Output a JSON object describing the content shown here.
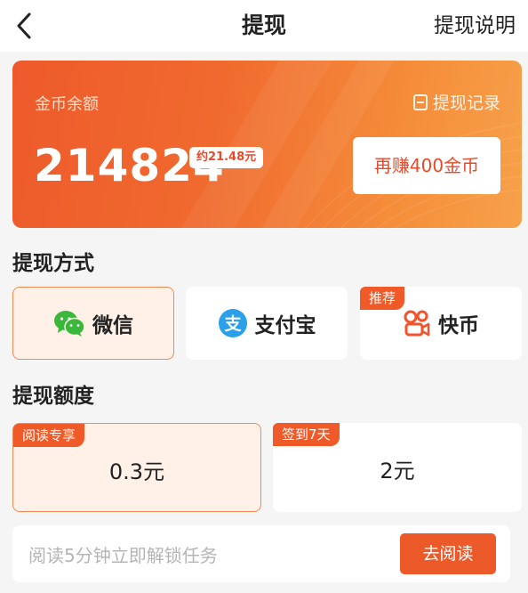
{
  "nav": {
    "title": "提现",
    "help_label": "提现说明",
    "back_icon": "chevron-left-icon"
  },
  "balance": {
    "label": "金币余额",
    "records_label": "提现记录",
    "coins": "214824",
    "approx_cash": "约21.48元",
    "earn_button": "再赚400金币"
  },
  "methods_section": {
    "title": "提现方式",
    "methods": [
      {
        "label": "微信",
        "icon": "wechat-icon",
        "selected": true
      },
      {
        "label": "支付宝",
        "icon": "alipay-icon",
        "selected": false
      },
      {
        "label": "快币",
        "icon": "kuaishou-icon",
        "tag": "推荐",
        "selected": false
      }
    ]
  },
  "amount_section": {
    "title": "提现额度",
    "options": [
      {
        "value": "0.3元",
        "tag": "阅读专享",
        "selected": true
      },
      {
        "value": "2元",
        "tag": "签到7天",
        "selected": false
      }
    ]
  },
  "task": {
    "text": "阅读5分钟立即解锁任务",
    "button": "去阅读"
  },
  "colors": {
    "accent": "#ec5a29",
    "selected_bg": "#fff1e8",
    "card_gradient_start": "#ee5a2c",
    "card_gradient_end": "#f7a14a"
  }
}
